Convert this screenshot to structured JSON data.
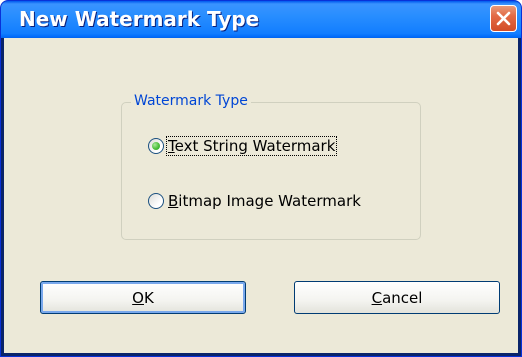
{
  "window": {
    "title": "New Watermark Type"
  },
  "groupbox": {
    "legend": "Watermark Type"
  },
  "options": [
    {
      "mnemonic": "T",
      "rest": "ext String Watermark",
      "selected": true
    },
    {
      "mnemonic": "B",
      "rest": "itmap Image Watermark",
      "selected": false
    }
  ],
  "buttons": {
    "ok": {
      "mnemonic": "O",
      "rest": "K"
    },
    "cancel": {
      "mnemonic": "C",
      "rest": "ancel"
    }
  },
  "colors": {
    "titlebar": "#288eff",
    "client": "#ece9d8",
    "legend_text": "#0046d5",
    "close": "#e36a45"
  },
  "icons": {
    "close": "close-icon"
  }
}
